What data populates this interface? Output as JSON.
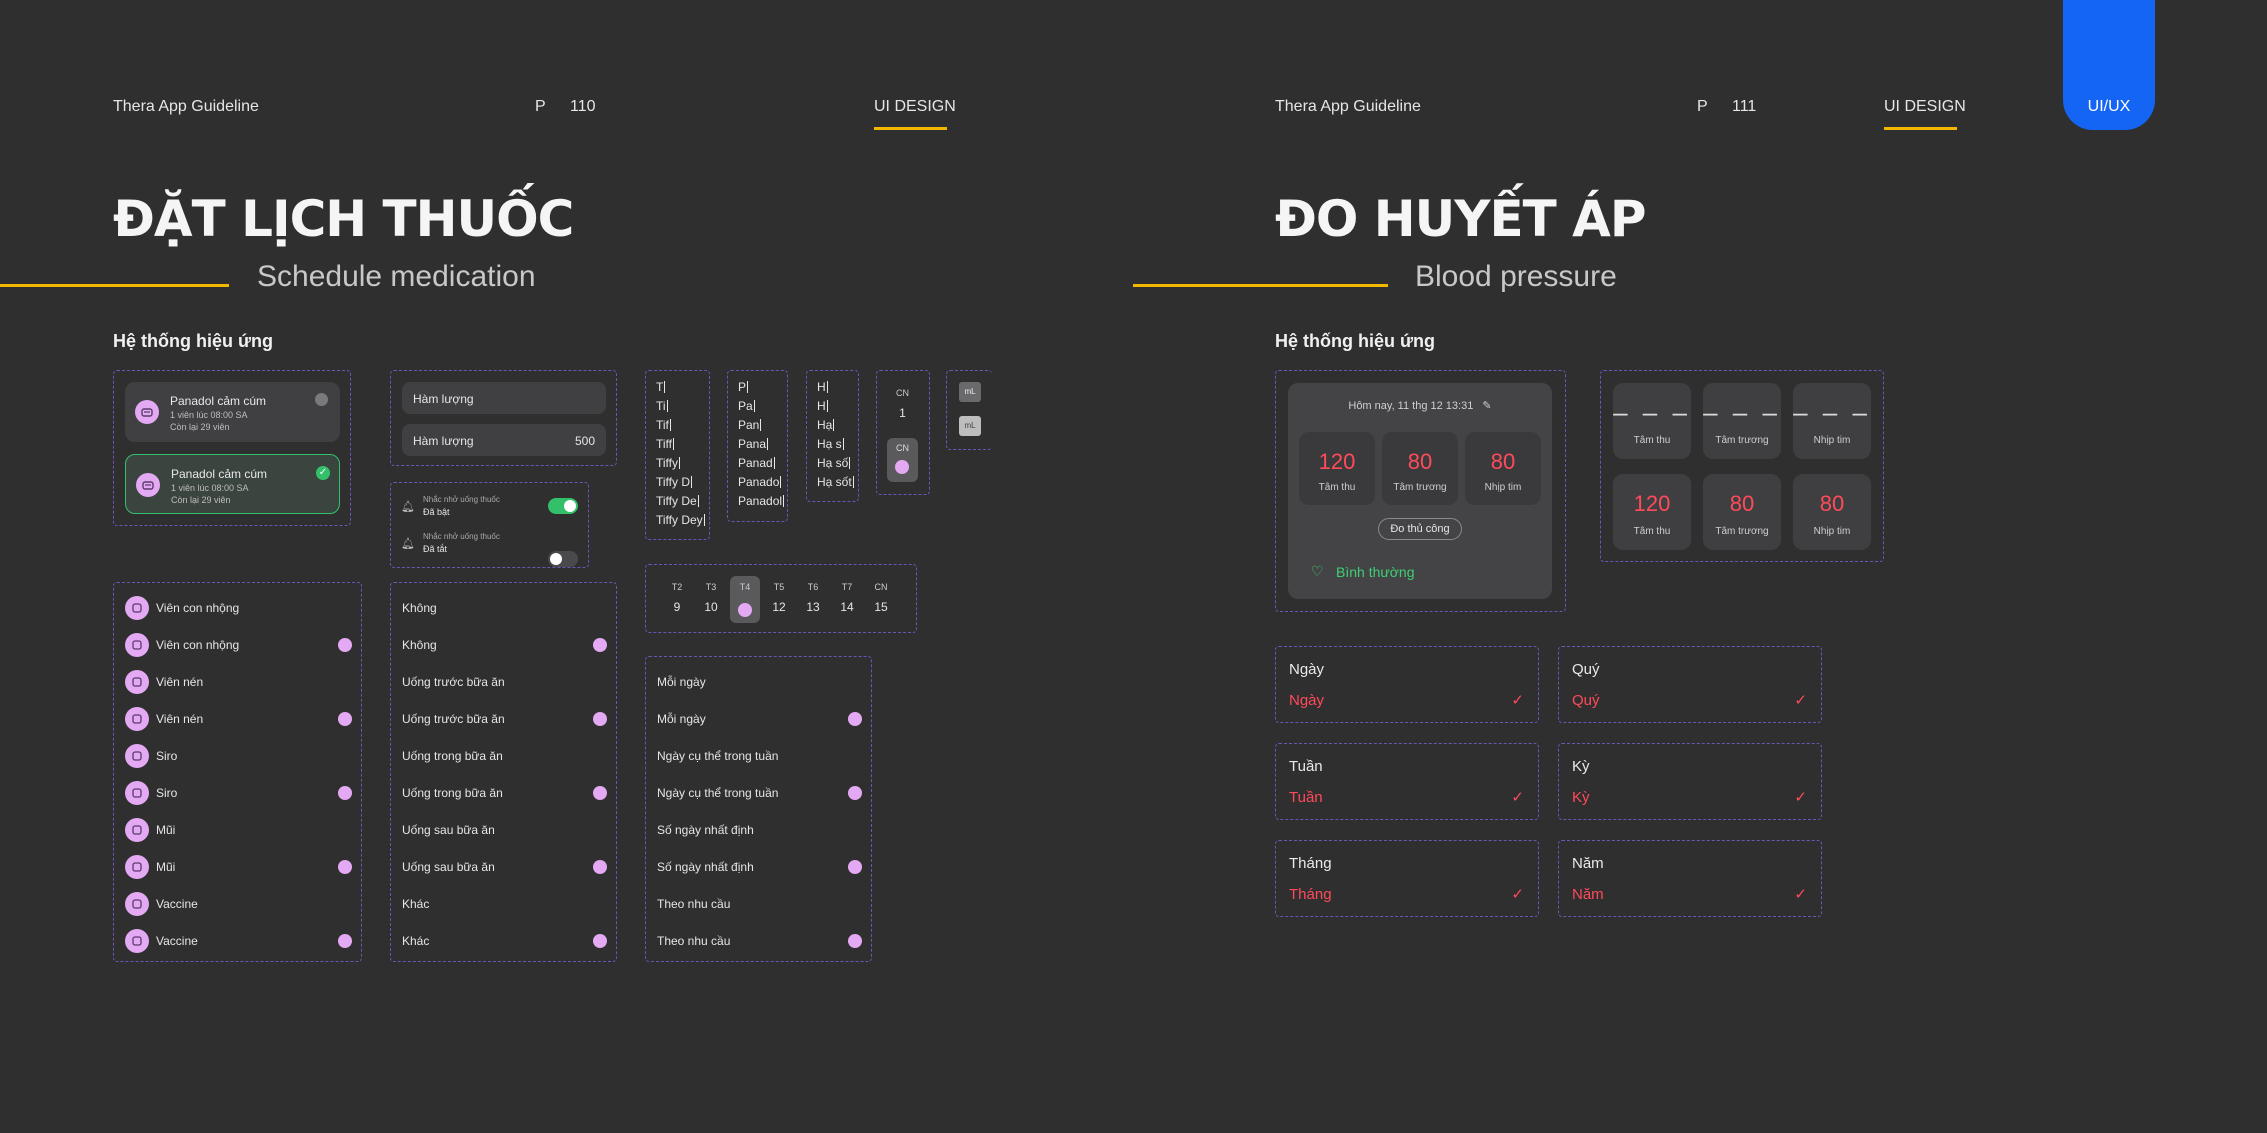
{
  "left": {
    "header": {
      "brand": "Thera App Guideline",
      "page_prefix": "P",
      "page_num": "110",
      "category": "UI DESIGN"
    },
    "title": "ĐẶT LỊCH THUỐC",
    "subtitle": "Schedule medication",
    "section": "Hệ thống hiệu ứng",
    "med_cards": [
      {
        "name": "Panadol cảm cúm",
        "dose": "1 viên lúc 08:00 SA",
        "remain": "Còn lại 29 viên"
      },
      {
        "name": "Panadol cảm cúm",
        "dose": "1 viên lúc 08:00 SA",
        "remain": "Còn lại 29 viên"
      }
    ],
    "dosage": {
      "label1": "Hàm lượng",
      "label2": "Hàm lượng",
      "value2": "500"
    },
    "reminders": [
      {
        "title": "Nhắc nhở uống thuốc",
        "state": "Đã bật"
      },
      {
        "title": "Nhắc nhở uống thuốc",
        "state": "Đã tắt"
      }
    ],
    "typing_col1": [
      "T",
      "Ti",
      "Tif",
      "Tiff",
      "Tiffy",
      "Tiffy D",
      "Tiffy De",
      "Tiffy Dey"
    ],
    "typing_col2": [
      "P",
      "Pa",
      "Pan",
      "Pana",
      "Panad",
      "Panado",
      "Panadol"
    ],
    "typing_col3": [
      "H",
      "H",
      "Hạ",
      "Hạ s",
      "Hạ số",
      "Hạ sốt"
    ],
    "cn_day": {
      "label": "CN",
      "num": "1",
      "label2": "CN"
    },
    "unit": {
      "a": "mL",
      "b": "mL"
    },
    "week": [
      {
        "d": "T2",
        "n": "9"
      },
      {
        "d": "T3",
        "n": "10"
      },
      {
        "d": "T4",
        "n": ""
      },
      {
        "d": "T5",
        "n": "12"
      },
      {
        "d": "T6",
        "n": "13"
      },
      {
        "d": "T7",
        "n": "14"
      },
      {
        "d": "CN",
        "n": "15"
      }
    ],
    "forms": [
      "Viên con nhộng",
      "Viên con nhộng",
      "Viên nén",
      "Viên nén",
      "Siro",
      "Siro",
      "Mũi",
      "Mũi",
      "Vaccine",
      "Vaccine"
    ],
    "meals": [
      "Không",
      "Không",
      "Uống trước bữa ăn",
      "Uống trước bữa ăn",
      "Uống trong bữa ăn",
      "Uống trong bữa ăn",
      "Uống sau bữa ăn",
      "Uống sau bữa ăn",
      "Khác",
      "Khác"
    ],
    "freq": [
      "Mỗi ngày",
      "Mỗi ngày",
      "Ngày cụ thể trong tuần",
      "Ngày cụ thể trong tuần",
      "Số ngày nhất định",
      "Số ngày nhất định",
      "Theo nhu cầu",
      "Theo nhu cầu"
    ]
  },
  "right": {
    "header": {
      "brand": "Thera App Guideline",
      "page_prefix": "P",
      "page_num": "111",
      "category": "UI DESIGN",
      "badge": "UI/UX"
    },
    "title": "ĐO HUYẾT ÁP",
    "subtitle": "Blood pressure",
    "section": "Hệ thống hiệu ứng",
    "measure": {
      "date": "Hôm nay, 11 thg 12 13:31",
      "values": [
        {
          "v": "120",
          "l": "Tâm thu"
        },
        {
          "v": "80",
          "l": "Tâm trương"
        },
        {
          "v": "80",
          "l": "Nhịp tim"
        }
      ],
      "manual_btn": "Đo thủ công",
      "status": "Bình thường"
    },
    "empty_tiles": [
      {
        "v": "– – –",
        "l": "Tâm thu"
      },
      {
        "v": "– – –",
        "l": "Tâm trương"
      },
      {
        "v": "– – –",
        "l": "Nhịp tim"
      }
    ],
    "filled_tiles": [
      {
        "v": "120",
        "l": "Tâm thu"
      },
      {
        "v": "80",
        "l": "Tâm trương"
      },
      {
        "v": "80",
        "l": "Nhịp tim"
      }
    ],
    "selectors": [
      {
        "t": "Ngày",
        "v": "Ngày"
      },
      {
        "t": "Quý",
        "v": "Quý"
      },
      {
        "t": "Tuần",
        "v": "Tuần"
      },
      {
        "t": "Kỳ",
        "v": "Kỳ"
      },
      {
        "t": "Tháng",
        "v": "Tháng"
      },
      {
        "t": "Năm",
        "v": "Năm"
      }
    ]
  },
  "colors": {
    "bg": "#2f2f30",
    "accent_yellow": "#f2b800",
    "accent_blue": "#1565f5",
    "accent_pink": "#e4a9f3",
    "value_red": "#ff4a5a",
    "status_green": "#3ecf73"
  }
}
